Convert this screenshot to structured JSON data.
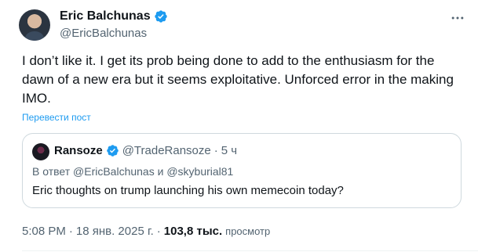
{
  "author": {
    "name": "Eric Balchunas",
    "handle": "@EricBalchunas"
  },
  "tweet": {
    "text": "I don’t like it. I get its prob being done to add to the enthusiasm for the dawn of a new era but it seems exploitative. Unforced error in the making IMO.",
    "translate_label": "Перевести пост"
  },
  "quote": {
    "name": "Ransoze",
    "handle": "@TradeRansoze",
    "separator": "·",
    "time": "5 ч",
    "reply_to": "В ответ @EricBalchunas и @skyburial81",
    "text": "Eric thoughts on trump launching his own memecoin today?"
  },
  "meta": {
    "time": "5:08 PM",
    "sep1": "·",
    "date": "18 янв. 2025 г.",
    "sep2": "·",
    "views_count": "103,8 тыс.",
    "views_label": "просмотр"
  },
  "icons": {
    "verified": "verified-badge-icon",
    "more": "more-horizontal-icon"
  },
  "colors": {
    "accent": "#1d9bf0",
    "secondary_text": "#536471",
    "border": "#cfd9de"
  }
}
